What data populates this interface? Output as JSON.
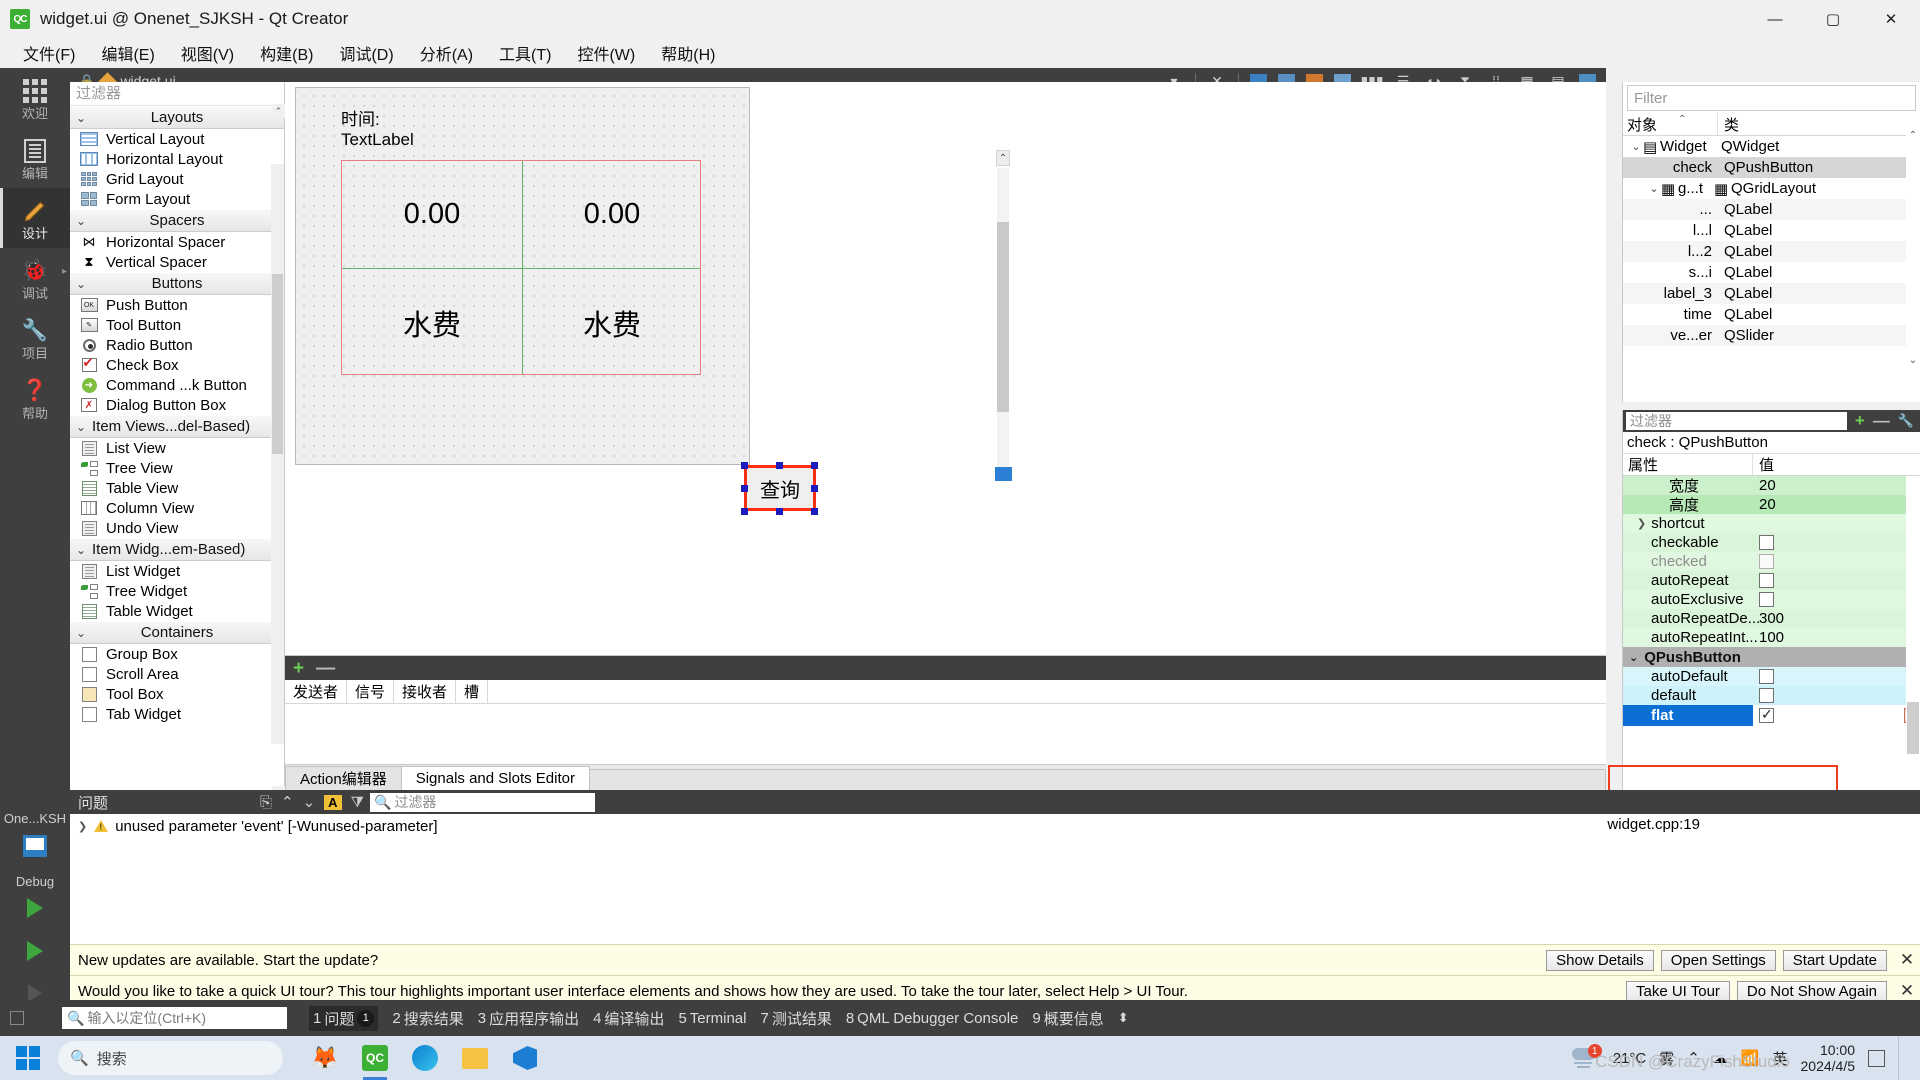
{
  "titlebar": {
    "logo": "QC",
    "title": "widget.ui @ Onenet_SJKSH - Qt Creator",
    "minimize": "—",
    "maximize": "▢",
    "close": "✕"
  },
  "menubar": {
    "items": [
      {
        "label": "文件(F)"
      },
      {
        "label": "编辑(E)"
      },
      {
        "label": "视图(V)"
      },
      {
        "label": "构建(B)"
      },
      {
        "label": "调试(D)"
      },
      {
        "label": "分析(A)"
      },
      {
        "label": "工具(T)"
      },
      {
        "label": "控件(W)"
      },
      {
        "label": "帮助(H)"
      }
    ]
  },
  "modebar": {
    "items": [
      {
        "label": "欢迎",
        "icon": "grid-icon",
        "active": false
      },
      {
        "label": "编辑",
        "icon": "document-icon",
        "active": false
      },
      {
        "label": "设计",
        "icon": "pencil-icon",
        "active": true
      },
      {
        "label": "调试",
        "icon": "bug-icon",
        "active": false
      },
      {
        "label": "项目",
        "icon": "wrench-icon",
        "active": false
      },
      {
        "label": "帮助",
        "icon": "question-icon",
        "active": false
      }
    ],
    "kit_label": "One...KSH",
    "debug_label": "Debug"
  },
  "widgetbox": {
    "filter_placeholder": "过滤器",
    "sections": [
      {
        "title": "Layouts",
        "items": [
          {
            "label": "Vertical Layout",
            "icon": "vertical-layout-icon"
          },
          {
            "label": "Horizontal Layout",
            "icon": "horizontal-layout-icon"
          },
          {
            "label": "Grid Layout",
            "icon": "grid-layout-icon"
          },
          {
            "label": "Form Layout",
            "icon": "form-layout-icon"
          }
        ]
      },
      {
        "title": "Spacers",
        "items": [
          {
            "label": "Horizontal Spacer",
            "icon": "horizontal-spacer-icon"
          },
          {
            "label": "Vertical Spacer",
            "icon": "vertical-spacer-icon"
          }
        ]
      },
      {
        "title": "Buttons",
        "items": [
          {
            "label": "Push Button",
            "icon": "push-button-icon"
          },
          {
            "label": "Tool Button",
            "icon": "tool-button-icon"
          },
          {
            "label": "Radio Button",
            "icon": "radio-button-icon"
          },
          {
            "label": "Check Box",
            "icon": "check-box-icon"
          },
          {
            "label": "Command ...k Button",
            "icon": "command-link-icon"
          },
          {
            "label": "Dialog Button Box",
            "icon": "dialog-button-box-icon"
          }
        ]
      },
      {
        "title": "Item Views...del-Based)",
        "items": [
          {
            "label": "List View",
            "icon": "list-view-icon"
          },
          {
            "label": "Tree View",
            "icon": "tree-view-icon"
          },
          {
            "label": "Table View",
            "icon": "table-view-icon"
          },
          {
            "label": "Column View",
            "icon": "column-view-icon"
          },
          {
            "label": "Undo View",
            "icon": "undo-view-icon"
          }
        ]
      },
      {
        "title": "Item Widg...em-Based)",
        "items": [
          {
            "label": "List Widget",
            "icon": "list-widget-icon"
          },
          {
            "label": "Tree Widget",
            "icon": "tree-widget-icon"
          },
          {
            "label": "Table Widget",
            "icon": "table-widget-icon"
          }
        ]
      },
      {
        "title": "Containers",
        "items": [
          {
            "label": "Group Box",
            "icon": "group-box-icon"
          },
          {
            "label": "Scroll Area",
            "icon": "scroll-area-icon"
          },
          {
            "label": "Tool Box",
            "icon": "tool-box-icon"
          },
          {
            "label": "Tab Widget",
            "icon": "tab-widget-icon"
          }
        ]
      }
    ]
  },
  "editor_tab": {
    "filename": "widget.ui",
    "dropdown": "▾",
    "close": "✕"
  },
  "canvas": {
    "label_time": "时间:",
    "label_textlabel": "TextLabel",
    "grid_cells": [
      "0.00",
      "0.00",
      "水费",
      "水费"
    ],
    "button_label": "查询"
  },
  "signals_slots": {
    "add": "+",
    "remove": "—",
    "columns": [
      "发送者",
      "信号",
      "接收者",
      "槽"
    ],
    "tabs": [
      {
        "label": "Action编辑器",
        "active": false
      },
      {
        "label": "Signals and Slots Editor",
        "active": true
      }
    ]
  },
  "object_inspector": {
    "filter_placeholder": "Filter",
    "columns": [
      "对象",
      "类"
    ],
    "rows": [
      {
        "name": "Widget",
        "class": "QWidget",
        "depth": 0,
        "expandable": true,
        "selected": false
      },
      {
        "name": "check",
        "class": "QPushButton",
        "depth": 1,
        "expandable": false,
        "selected": true,
        "highlighted": true
      },
      {
        "name": "g...t",
        "class": "QGridLayout",
        "depth": 1,
        "expandable": true,
        "selected": false
      },
      {
        "name": "...",
        "class": "QLabel",
        "depth": 2,
        "expandable": false,
        "selected": false
      },
      {
        "name": "l...l",
        "class": "QLabel",
        "depth": 2,
        "expandable": false,
        "selected": false
      },
      {
        "name": "l...2",
        "class": "QLabel",
        "depth": 2,
        "expandable": false,
        "selected": false
      },
      {
        "name": "s...i",
        "class": "QLabel",
        "depth": 2,
        "expandable": false,
        "selected": false
      },
      {
        "name": "label_3",
        "class": "QLabel",
        "depth": 1,
        "expandable": false,
        "selected": false
      },
      {
        "name": "time",
        "class": "QLabel",
        "depth": 1,
        "expandable": false,
        "selected": false
      },
      {
        "name": "ve...er",
        "class": "QSlider",
        "depth": 1,
        "expandable": false,
        "selected": false
      }
    ]
  },
  "property_editor": {
    "filter_placeholder": "过滤器",
    "add_icon": "+",
    "remove_icon": "—",
    "config_icon": "wrench-icon",
    "object_header": "check : QPushButton",
    "columns": [
      "属性",
      "值"
    ],
    "rows": [
      {
        "key": "宽度",
        "value": "20",
        "type": "text",
        "shade": "g1",
        "indent": 2
      },
      {
        "key": "高度",
        "value": "20",
        "type": "text",
        "shade": "g2",
        "indent": 2
      },
      {
        "key": "shortcut",
        "value": "",
        "type": "text",
        "shade": "g3",
        "indent": 1,
        "expandable": true
      },
      {
        "key": "checkable",
        "value": false,
        "type": "checkbox",
        "shade": "g4",
        "indent": 1
      },
      {
        "key": "checked",
        "value": false,
        "type": "checkbox",
        "shade": "g3",
        "indent": 1,
        "disabled": true
      },
      {
        "key": "autoRepeat",
        "value": false,
        "type": "checkbox",
        "shade": "g4",
        "indent": 1
      },
      {
        "key": "autoExclusive",
        "value": false,
        "type": "checkbox",
        "shade": "g3",
        "indent": 1
      },
      {
        "key": "autoRepeatDe...",
        "value": "300",
        "type": "text",
        "shade": "g4",
        "indent": 1
      },
      {
        "key": "autoRepeatInt...",
        "value": "100",
        "type": "text",
        "shade": "g3",
        "indent": 1
      }
    ],
    "group": "QPushButton",
    "group_rows": [
      {
        "key": "autoDefault",
        "value": false,
        "type": "checkbox",
        "shade": "blu1",
        "indent": 1
      },
      {
        "key": "default",
        "value": false,
        "type": "checkbox",
        "shade": "blu2",
        "indent": 1
      },
      {
        "key": "flat",
        "value": true,
        "type": "checkbox",
        "shade": "blu1",
        "indent": 1,
        "selected": true,
        "highlighted": true
      }
    ]
  },
  "issues": {
    "title": "问题",
    "filter_placeholder": "过滤器",
    "rows": [
      {
        "text": "unused parameter 'event' [-Wunused-parameter]",
        "severity": "warning"
      }
    ],
    "file": "widget.cpp:19"
  },
  "notifications": [
    {
      "message": "New updates are available. Start the update?",
      "buttons": [
        "Show Details",
        "Open Settings",
        "Start Update"
      ],
      "close": "✕"
    },
    {
      "message": "Would you like to take a quick UI tour? This tour highlights important user interface elements and shows how they are used. To take the tour later, select Help > UI Tour.",
      "buttons": [
        "Take UI Tour",
        "Do Not Show Again"
      ],
      "close": "✕"
    }
  ],
  "statusbar": {
    "locator_placeholder": "输入以定位(Ctrl+K)",
    "outputs": [
      {
        "num": "1",
        "label": "问题",
        "badge": "1",
        "active": true
      },
      {
        "num": "2",
        "label": "搜索结果",
        "badge": "",
        "active": false
      },
      {
        "num": "3",
        "label": "应用程序输出",
        "badge": "",
        "active": false
      },
      {
        "num": "4",
        "label": "编译输出",
        "badge": "",
        "active": false
      },
      {
        "num": "5",
        "label": "Terminal",
        "badge": "",
        "active": false
      },
      {
        "num": "7",
        "label": "测试结果",
        "badge": "",
        "active": false
      },
      {
        "num": "8",
        "label": "QML Debugger Console",
        "badge": "",
        "active": false
      },
      {
        "num": "9",
        "label": "概要信息",
        "badge": "",
        "active": false
      }
    ],
    "more": "⬍"
  },
  "taskbar": {
    "search_placeholder": "搜索",
    "apps": [
      {
        "name": "fox-wallpaper-icon"
      },
      {
        "name": "qt-creator-icon",
        "active": true
      },
      {
        "name": "edge-icon"
      },
      {
        "name": "file-explorer-icon"
      },
      {
        "name": "vscode-icon"
      }
    ],
    "tray": {
      "weather_temp": "21°C",
      "weather_desc": "雾",
      "weather_badge": "1",
      "chevron": "⌃",
      "ime": "英",
      "time": "10:00",
      "date": "2024/4/5"
    },
    "watermark": "CSDN @CrazyFishStudio"
  }
}
